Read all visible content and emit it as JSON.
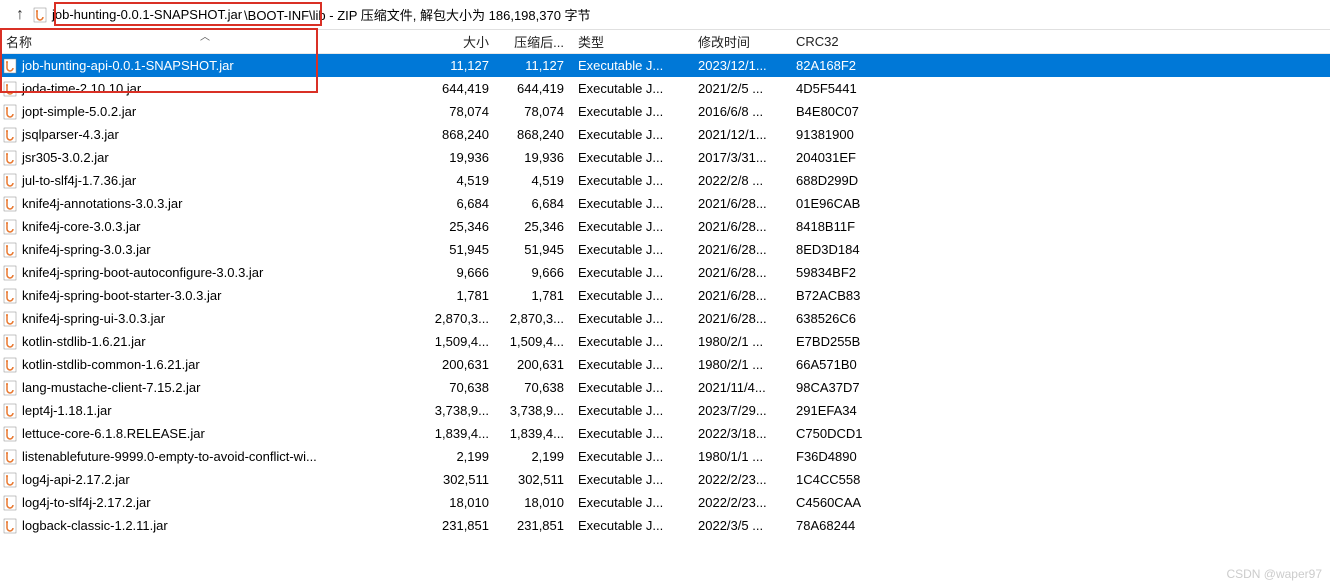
{
  "toolbar": {
    "up_arrow": "↑",
    "path_highlighted": "job-hunting-0.0.1-SNAPSHOT.jar",
    "path_suffix": "\\BOOT-INF\\lib - ZIP 压缩文件, 解包大小为 186,198,370 字节"
  },
  "columns": {
    "name": "名称",
    "size": "大小",
    "compressed": "压缩后...",
    "type": "类型",
    "modified": "修改时间",
    "crc": "CRC32"
  },
  "icon_alt": "jar-file-icon",
  "rows": [
    {
      "name": "job-hunting-api-0.0.1-SNAPSHOT.jar",
      "size": "11,127",
      "comp": "11,127",
      "type": "Executable J...",
      "date": "2023/12/1...",
      "crc": "82A168F2",
      "selected": true
    },
    {
      "name": "joda-time-2.10.10.jar",
      "size": "644,419",
      "comp": "644,419",
      "type": "Executable J...",
      "date": "2021/2/5 ...",
      "crc": "4D5F5441"
    },
    {
      "name": "jopt-simple-5.0.2.jar",
      "size": "78,074",
      "comp": "78,074",
      "type": "Executable J...",
      "date": "2016/6/8 ...",
      "crc": "B4E80C07"
    },
    {
      "name": "jsqlparser-4.3.jar",
      "size": "868,240",
      "comp": "868,240",
      "type": "Executable J...",
      "date": "2021/12/1...",
      "crc": "91381900"
    },
    {
      "name": "jsr305-3.0.2.jar",
      "size": "19,936",
      "comp": "19,936",
      "type": "Executable J...",
      "date": "2017/3/31...",
      "crc": "204031EF"
    },
    {
      "name": "jul-to-slf4j-1.7.36.jar",
      "size": "4,519",
      "comp": "4,519",
      "type": "Executable J...",
      "date": "2022/2/8 ...",
      "crc": "688D299D"
    },
    {
      "name": "knife4j-annotations-3.0.3.jar",
      "size": "6,684",
      "comp": "6,684",
      "type": "Executable J...",
      "date": "2021/6/28...",
      "crc": "01E96CAB"
    },
    {
      "name": "knife4j-core-3.0.3.jar",
      "size": "25,346",
      "comp": "25,346",
      "type": "Executable J...",
      "date": "2021/6/28...",
      "crc": "8418B11F"
    },
    {
      "name": "knife4j-spring-3.0.3.jar",
      "size": "51,945",
      "comp": "51,945",
      "type": "Executable J...",
      "date": "2021/6/28...",
      "crc": "8ED3D184"
    },
    {
      "name": "knife4j-spring-boot-autoconfigure-3.0.3.jar",
      "size": "9,666",
      "comp": "9,666",
      "type": "Executable J...",
      "date": "2021/6/28...",
      "crc": "59834BF2"
    },
    {
      "name": "knife4j-spring-boot-starter-3.0.3.jar",
      "size": "1,781",
      "comp": "1,781",
      "type": "Executable J...",
      "date": "2021/6/28...",
      "crc": "B72ACB83"
    },
    {
      "name": "knife4j-spring-ui-3.0.3.jar",
      "size": "2,870,3...",
      "comp": "2,870,3...",
      "type": "Executable J...",
      "date": "2021/6/28...",
      "crc": "638526C6"
    },
    {
      "name": "kotlin-stdlib-1.6.21.jar",
      "size": "1,509,4...",
      "comp": "1,509,4...",
      "type": "Executable J...",
      "date": "1980/2/1 ...",
      "crc": "E7BD255B"
    },
    {
      "name": "kotlin-stdlib-common-1.6.21.jar",
      "size": "200,631",
      "comp": "200,631",
      "type": "Executable J...",
      "date": "1980/2/1 ...",
      "crc": "66A571B0"
    },
    {
      "name": "lang-mustache-client-7.15.2.jar",
      "size": "70,638",
      "comp": "70,638",
      "type": "Executable J...",
      "date": "2021/11/4...",
      "crc": "98CA37D7"
    },
    {
      "name": "lept4j-1.18.1.jar",
      "size": "3,738,9...",
      "comp": "3,738,9...",
      "type": "Executable J...",
      "date": "2023/7/29...",
      "crc": "291EFA34"
    },
    {
      "name": "lettuce-core-6.1.8.RELEASE.jar",
      "size": "1,839,4...",
      "comp": "1,839,4...",
      "type": "Executable J...",
      "date": "2022/3/18...",
      "crc": "C750DCD1"
    },
    {
      "name": "listenablefuture-9999.0-empty-to-avoid-conflict-wi...",
      "size": "2,199",
      "comp": "2,199",
      "type": "Executable J...",
      "date": "1980/1/1 ...",
      "crc": "F36D4890"
    },
    {
      "name": "log4j-api-2.17.2.jar",
      "size": "302,511",
      "comp": "302,511",
      "type": "Executable J...",
      "date": "2022/2/23...",
      "crc": "1C4CC558"
    },
    {
      "name": "log4j-to-slf4j-2.17.2.jar",
      "size": "18,010",
      "comp": "18,010",
      "type": "Executable J...",
      "date": "2022/2/23...",
      "crc": "C4560CAA"
    },
    {
      "name": "logback-classic-1.2.11.jar",
      "size": "231,851",
      "comp": "231,851",
      "type": "Executable J...",
      "date": "2022/3/5 ...",
      "crc": "78A68244"
    }
  ],
  "watermark": "CSDN @waper97"
}
